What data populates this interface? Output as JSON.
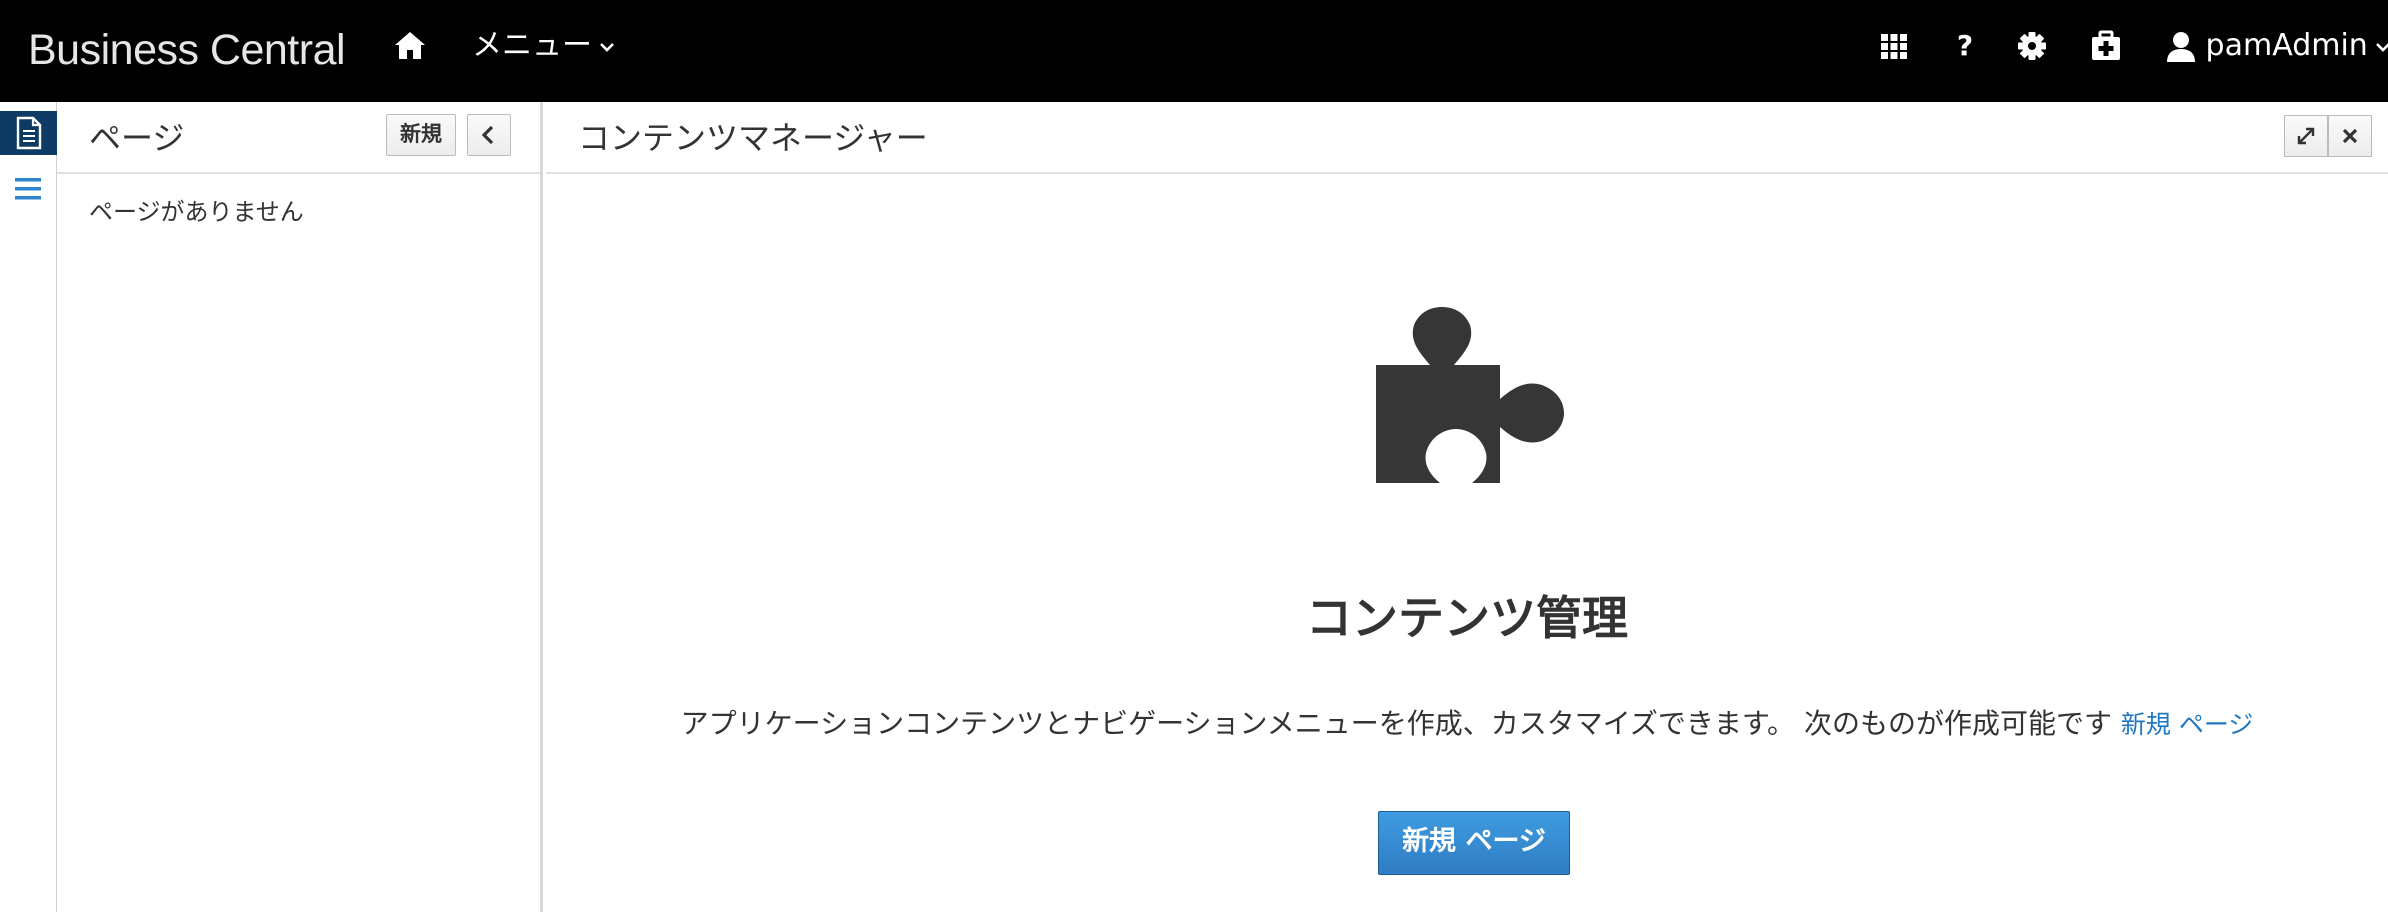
{
  "navbar": {
    "brand": "Business Central",
    "menu_label": "メニュー",
    "help_label": "?",
    "user_name": "pamAdmin",
    "icons": [
      "home-icon",
      "app-launcher-icon",
      "help-icon",
      "gear-icon",
      "first-aid-kit-icon",
      "user-icon",
      "chevron-down-icon"
    ]
  },
  "rail": {
    "items": [
      {
        "icon": "document-icon",
        "active": true
      },
      {
        "icon": "hamburger-menu-icon",
        "active": false
      }
    ]
  },
  "pages_panel": {
    "title": "ページ",
    "new_button": "新規",
    "empty_text": "ページがありません"
  },
  "content": {
    "title": "コンテンツマネージャー",
    "empty_title": "コンテンツ管理",
    "description": "アプリケーションコンテンツとナビゲーションメニューを作成、カスタマイズできます。 次のものが作成可能です",
    "description_link": "新規 ページ",
    "primary_button": "新規 ページ"
  },
  "colors": {
    "navbar_bg": "#000000",
    "rail_active_bg": "#0e3b63",
    "link": "#1f77c0",
    "primary_button": "#3a8fd6",
    "text": "#333333"
  }
}
